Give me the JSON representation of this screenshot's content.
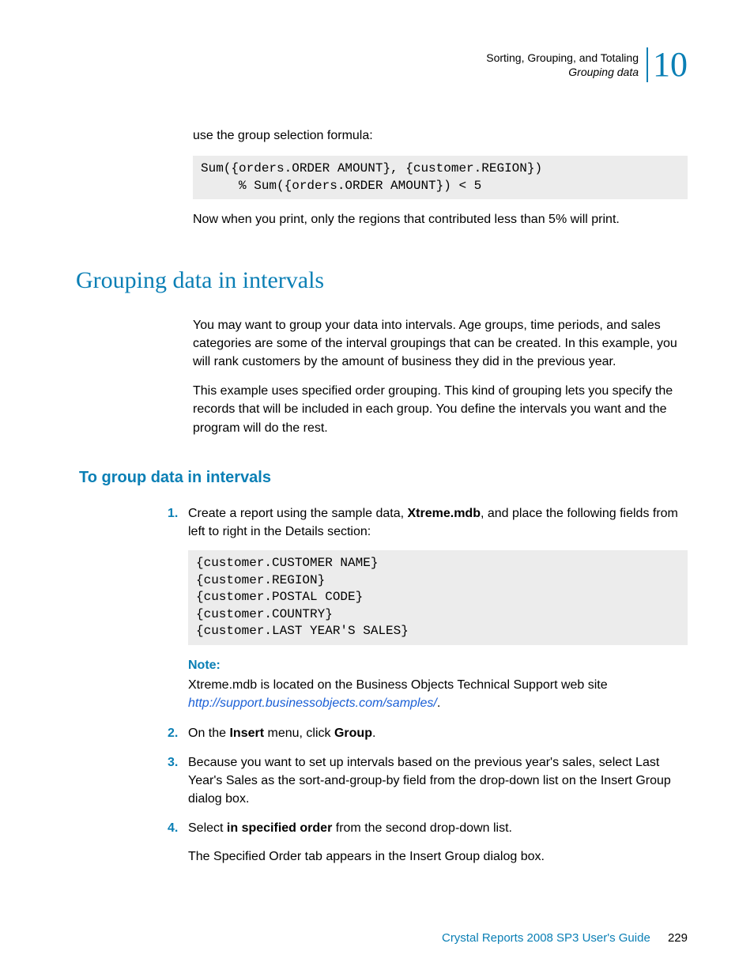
{
  "header": {
    "chapter_title": "Sorting, Grouping, and Totaling",
    "section_name": "Grouping data",
    "chapter_number": "10"
  },
  "intro": {
    "lead_in": "use the group selection formula:",
    "code": "Sum({orders.ORDER AMOUNT}, {customer.REGION})\n     % Sum({orders.ORDER AMOUNT}) < 5",
    "after": "Now when you print, only the regions that contributed less than 5% will print."
  },
  "section": {
    "title": "Grouping data in intervals",
    "p1": "You may want to group your data into intervals. Age groups, time periods, and sales categories are some of the interval groupings that can be created. In this example, you will rank customers by the amount of business they did in the previous year.",
    "p2": "This example uses specified order grouping. This kind of grouping lets you specify the records that will be included in each group. You define the intervals you want and the program will do the rest."
  },
  "subsection": {
    "title": "To group data in intervals"
  },
  "steps": {
    "s1": {
      "num": "1.",
      "text_before": "Create a report using the sample data, ",
      "bold": "Xtreme.mdb",
      "text_after": ", and place the following fields from left to right in the Details section:",
      "code": "{customer.CUSTOMER NAME}\n{customer.REGION}\n{customer.POSTAL CODE}\n{customer.COUNTRY}\n{customer.LAST YEAR'S SALES}",
      "note_label": "Note:",
      "note_text_before": "Xtreme.mdb is located on the Business Objects Technical Support web site ",
      "note_link": "http://support.businessobjects.com/samples/",
      "note_text_after": "."
    },
    "s2": {
      "num": "2.",
      "before": "On the ",
      "bold1": "Insert",
      "mid": " menu, click ",
      "bold2": "Group",
      "after": "."
    },
    "s3": {
      "num": "3.",
      "text": "Because you want to set up intervals based on the previous year's sales, select Last Year's Sales as the sort-and-group-by field from the drop-down list on the Insert Group dialog box."
    },
    "s4": {
      "num": "4.",
      "before": "Select ",
      "bold": "in specified order",
      "after": " from the second drop-down list.",
      "followup": "The Specified Order tab appears in the Insert Group dialog box."
    }
  },
  "footer": {
    "guide": "Crystal Reports 2008 SP3 User's Guide",
    "page": "229"
  }
}
